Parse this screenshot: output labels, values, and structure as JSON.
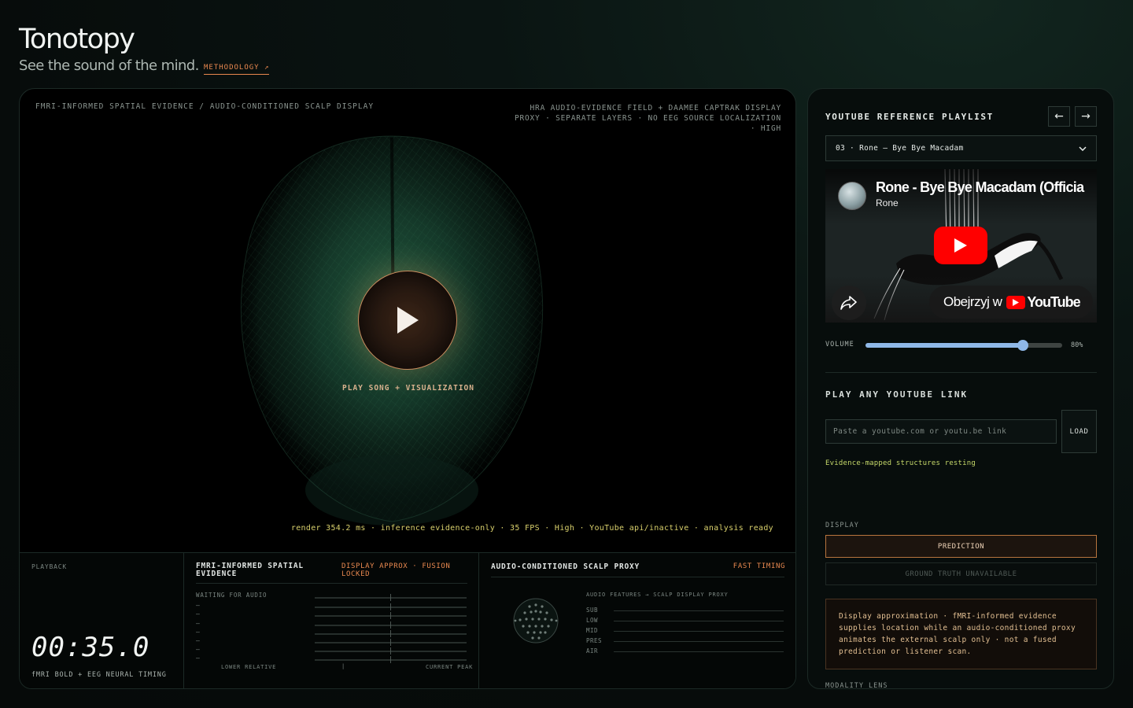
{
  "header": {
    "title": "Tonotopy",
    "tagline": "See the sound of the mind.",
    "methodology_link": "METHODOLOGY ↗"
  },
  "viz": {
    "top_left_label": "FMRI-INFORMED SPATIAL EVIDENCE / AUDIO-CONDITIONED SCALP DISPLAY",
    "top_right_line1": "HRA AUDIO-EVIDENCE FIELD + DAAMEE CAPTRAK DISPLAY",
    "top_right_line2": "PROXY · SEPARATE LAYERS · NO EEG SOURCE LOCALIZATION",
    "top_right_line3": "· HIGH",
    "play_label": "PLAY SONG + VISUALIZATION",
    "status": "render 354.2 ms · inference evidence-only · 35 FPS · High · YouTube api/inactive · analysis ready"
  },
  "playback": {
    "label": "PLAYBACK",
    "time": "00:35.0",
    "subtitle": "fMRI BOLD + EEG NEURAL TIMING"
  },
  "spatial": {
    "title": "FMRI-INFORMED SPATIAL EVIDENCE",
    "badge": "DISPLAY APPROX · FUSION LOCKED",
    "waiting": "WAITING FOR AUDIO",
    "rows": [
      "–",
      "–",
      "–",
      "–",
      "–",
      "–",
      "–",
      "–"
    ],
    "legend_left": "LOWER RELATIVE",
    "legend_mid": "|",
    "legend_right": "CURRENT PEAK"
  },
  "scalp": {
    "title": "AUDIO-CONDITIONED SCALP PROXY",
    "badge": "FAST TIMING",
    "features_label": "AUDIO FEATURES → SCALP DISPLAY PROXY",
    "bands": [
      "SUB",
      "LOW",
      "MID",
      "PRES",
      "AIR"
    ]
  },
  "side": {
    "title": "YOUTUBE REFERENCE PLAYLIST",
    "prev": "←",
    "next": "→",
    "selected_track": "03 · Rone — Bye Bye Macadam",
    "video": {
      "title": "Rone - Bye Bye Macadam (Officia",
      "channel": "Rone",
      "watch_on": "Obejrzyj w",
      "yt_word": "YouTube"
    },
    "volume_label": "VOLUME",
    "volume_value": "80%",
    "volume_level": 0.8,
    "link_heading": "PLAY ANY YOUTUBE LINK",
    "link_placeholder": "Paste a youtube.com or youtu.be link",
    "load_label": "LOAD",
    "evidence_note": "Evidence-mapped structures resting",
    "display_label": "DISPLAY",
    "prediction_btn": "PREDICTION",
    "ground_truth_btn": "GROUND TRUTH UNAVAILABLE",
    "info_text": "Display approximation · fMRI-informed evidence supplies location while an audio-conditioned proxy animates the external scalp only · not a fused prediction or listener scan.",
    "modality_label": "MODALITY LENS"
  },
  "colors": {
    "accent_orange": "#e8884f",
    "status_yellow": "#d9d06c",
    "volume_blue": "#8fb8e8",
    "brain_green": "#1f5a3e"
  }
}
